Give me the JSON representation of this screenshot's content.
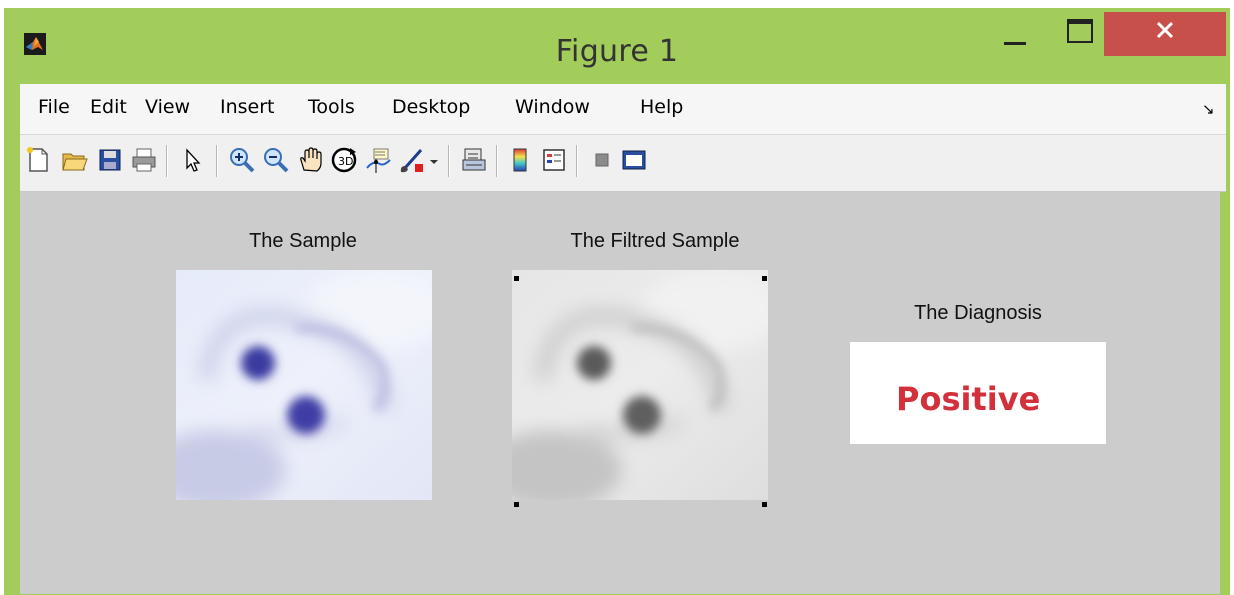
{
  "window": {
    "title": "Figure 1"
  },
  "menu": {
    "items": [
      "File",
      "Edit",
      "View",
      "Insert",
      "Tools",
      "Desktop",
      "Window",
      "Help"
    ]
  },
  "toolbar": {
    "icons": [
      "new-figure-icon",
      "open-file-icon",
      "save-icon",
      "print-icon",
      "edit-plot-icon",
      "zoom-in-icon",
      "zoom-out-icon",
      "pan-icon",
      "rotate-3d-icon",
      "data-cursor-icon",
      "brush-icon",
      "brush-dropdown-icon",
      "link-plot-icon",
      "insert-colorbar-icon",
      "insert-legend-icon",
      "hide-plot-tools-icon",
      "show-plot-tools-icon"
    ]
  },
  "figure": {
    "sample": {
      "title": "The Sample"
    },
    "filtered": {
      "title": "The Filtred Sample"
    },
    "diagnosis": {
      "title": "The Diagnosis",
      "result": "Positive",
      "result_color": "#d2303a"
    }
  },
  "colors": {
    "frame": "#a2cd5a",
    "close_button": "#c7504a",
    "canvas": "#cccccc"
  }
}
